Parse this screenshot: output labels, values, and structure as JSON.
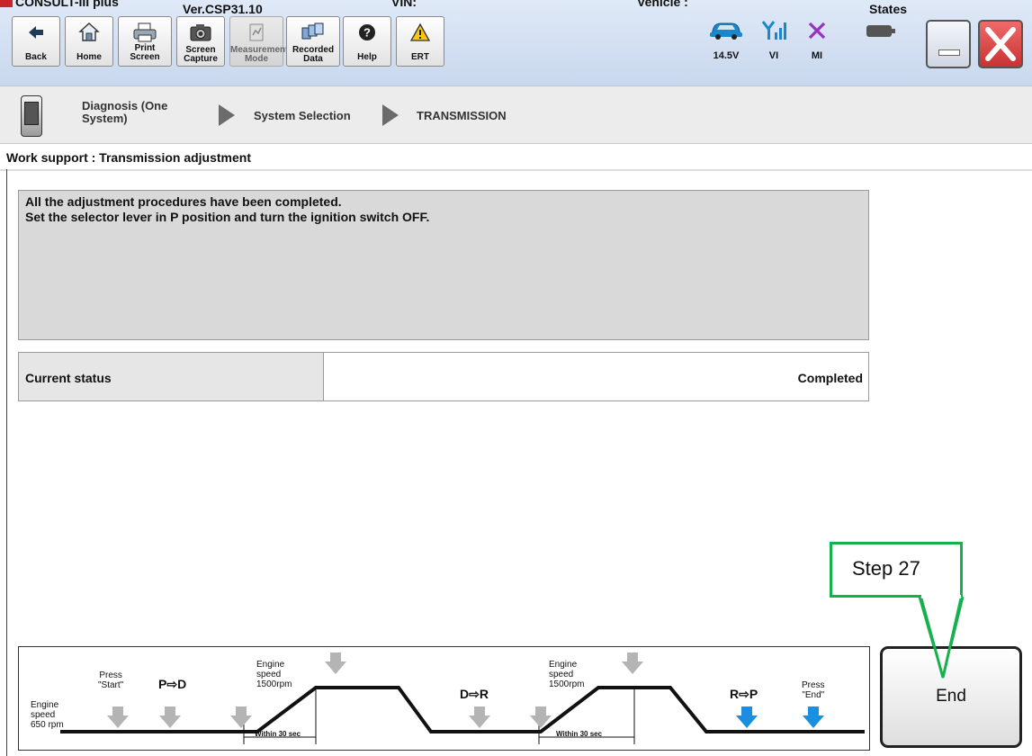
{
  "title_strip": {
    "app": "CONSULT-III plus",
    "version": "Ver.CSP31.10",
    "vin": "VIN:",
    "vehicle": "Vehicle :",
    "states": "States"
  },
  "toolbar": [
    {
      "label": "Back",
      "icon": "back-arrow-icon"
    },
    {
      "label": "Home",
      "icon": "home-icon"
    },
    {
      "label": "Print Screen",
      "icon": "printer-icon"
    },
    {
      "label": "Screen Capture",
      "icon": "camera-icon"
    },
    {
      "label": "Measurement Mode",
      "icon": "measurement-icon",
      "disabled": true
    },
    {
      "label": "Recorded Data",
      "icon": "recorded-data-icon"
    },
    {
      "label": "Help",
      "icon": "help-icon"
    },
    {
      "label": "ERT",
      "icon": "warning-icon"
    }
  ],
  "status_icons": [
    {
      "label": "14.5V",
      "icon": "car-battery-voltage-icon"
    },
    {
      "label": "VI",
      "icon": "signal-vi-icon"
    },
    {
      "label": "MI",
      "icon": "mi-x-icon"
    },
    {
      "label": "",
      "icon": "battery-icon"
    }
  ],
  "breadcrumb": {
    "step1": "Diagnosis (One",
    "step1b": "System)",
    "step2": "System Selection",
    "step3": "TRANSMISSION"
  },
  "work_support": {
    "title": "Work support : Transmission adjustment"
  },
  "message": {
    "line1": "All the adjustment procedures have been completed.",
    "line2": "Set the selector lever in P position and turn the ignition switch OFF."
  },
  "status": {
    "label": "Current status",
    "value": "Completed"
  },
  "diagram": {
    "engine_speed": [
      "Engine",
      "speed",
      "650 rpm"
    ],
    "press_start": [
      "Press",
      "\"Start\""
    ],
    "p_to_d": "P⇨D",
    "engine_1500_a": [
      "Engine",
      "speed",
      "1500rpm"
    ],
    "within_a": "Within 30 sec",
    "d_to_r": "D⇨R",
    "engine_1500_b": [
      "Engine",
      "speed",
      "1500rpm"
    ],
    "within_b": "Within 30 sec",
    "r_to_p": "R⇨P",
    "press_end": [
      "Press",
      "\"End\""
    ]
  },
  "end_button": {
    "label": "End"
  },
  "callout": {
    "text": "Step 27"
  },
  "colors": {
    "callout_green": "#16b04f",
    "arrow_blue": "#1a8fe0",
    "arrow_gray": "#b4b4b4",
    "close_red": "#e24a4a"
  }
}
